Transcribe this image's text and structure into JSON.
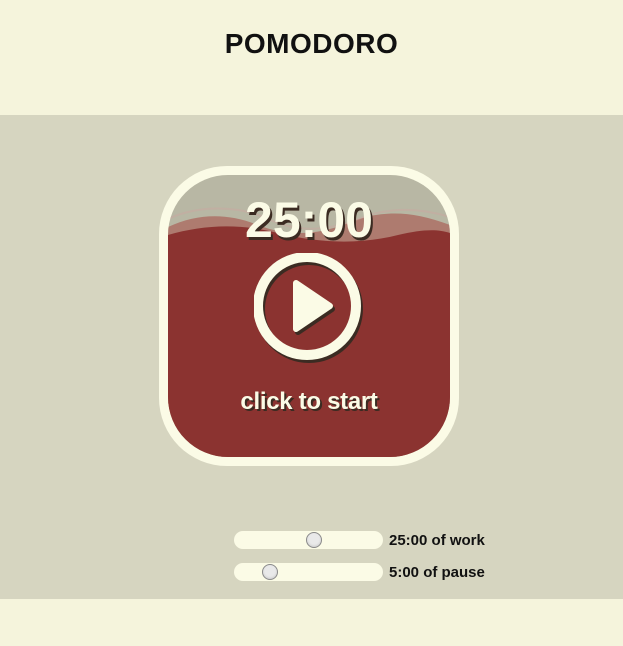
{
  "header": {
    "title": "POMODORO"
  },
  "timer": {
    "time": "25:00",
    "action_icon": "play-icon",
    "action_label": "click to start",
    "colors": {
      "frame": "#fbfbe6",
      "fill": "#8b3330",
      "empty": "#b8b7a4"
    }
  },
  "settings": {
    "work": {
      "label": "25:00 of work",
      "slider_fraction": 0.54
    },
    "pause": {
      "label": "5:00 of pause",
      "slider_fraction": 0.21
    }
  },
  "colors": {
    "page_bg": "#f5f4dc",
    "main_bg": "#d6d5c0",
    "text": "#111111"
  }
}
